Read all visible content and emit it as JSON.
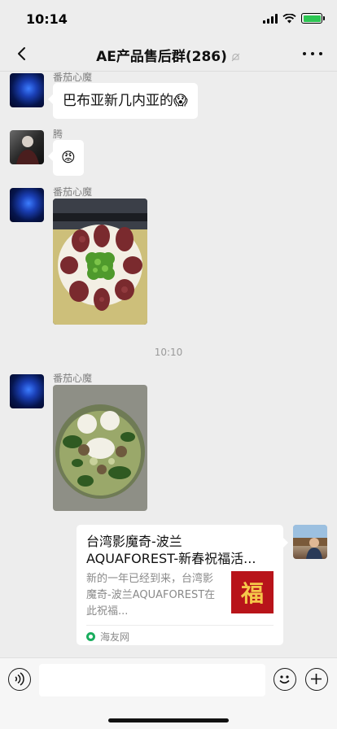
{
  "status": {
    "time": "10:14"
  },
  "header": {
    "title": "AE产品售后群(286)"
  },
  "messages": [
    {
      "sender": "番茄心魔",
      "text": "巴布亚新几内亚的😱"
    },
    {
      "sender": "腾",
      "text": "😡"
    },
    {
      "sender": "番茄心魔"
    },
    {
      "timestamp": "10:10"
    },
    {
      "sender": "番茄心魔"
    }
  ],
  "card": {
    "title": "台湾影魔奇-波兰AQUAFOREST-新春祝福活...",
    "description": "新的一年已经到来，台湾影魔奇-波兰AQUAFOREST在此祝福...",
    "thumb_char": "福",
    "source": "海友网"
  }
}
